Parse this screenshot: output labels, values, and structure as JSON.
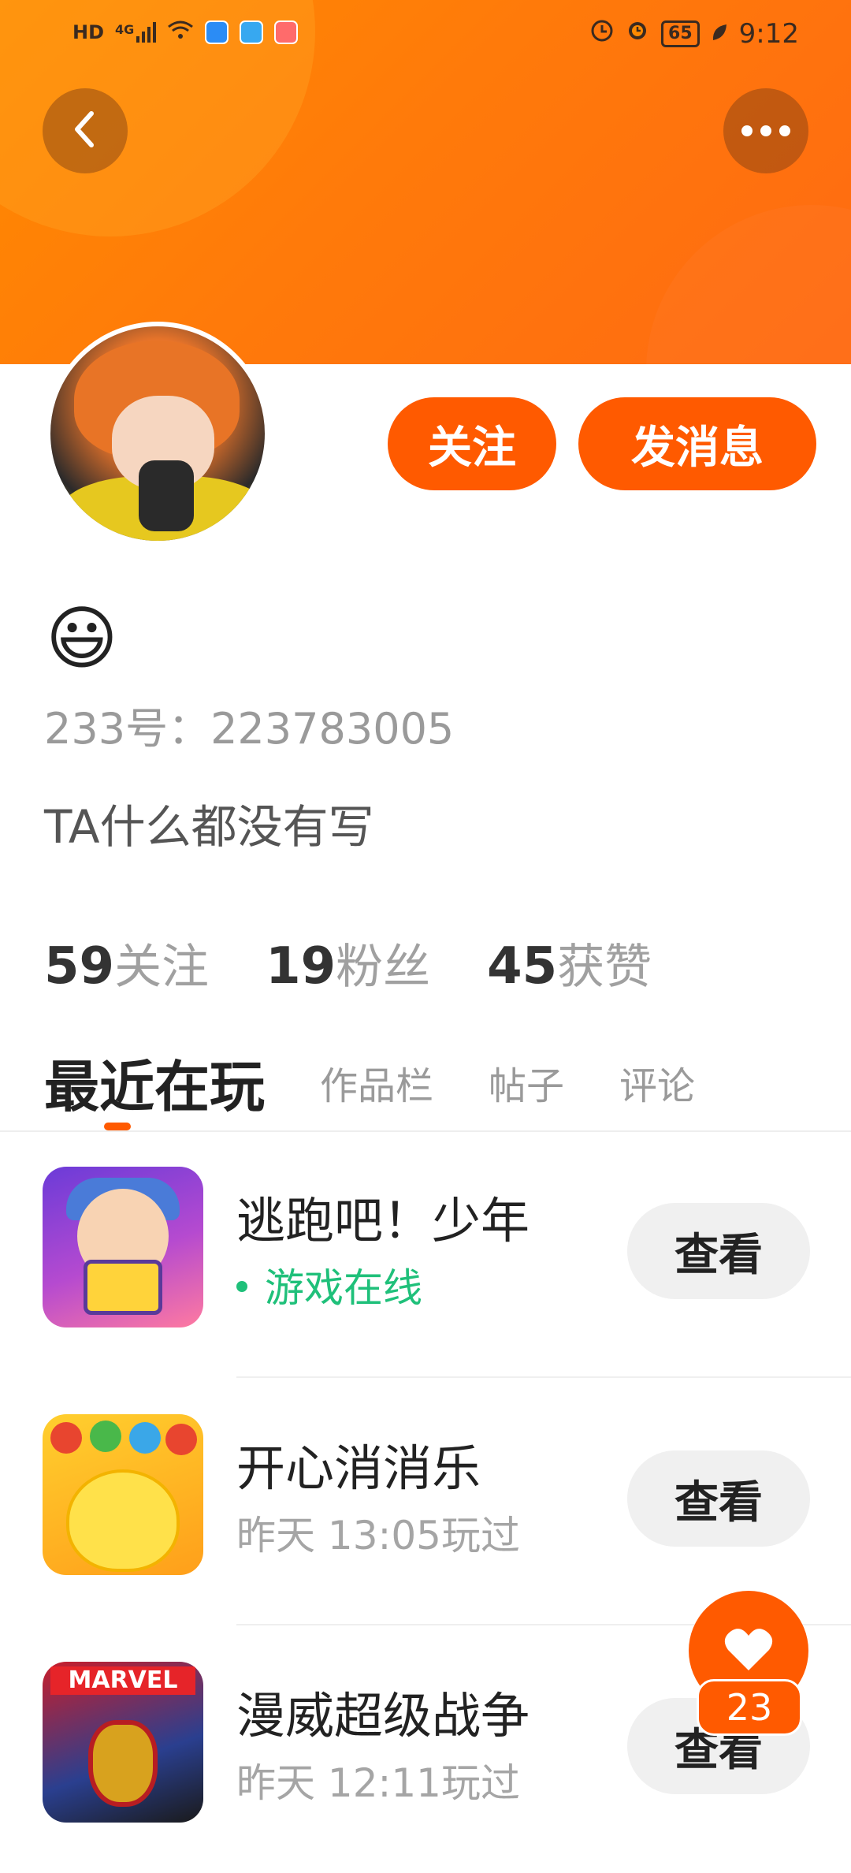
{
  "status_bar": {
    "left_label": "HD",
    "network": "4G",
    "battery": "65",
    "time": "9:12"
  },
  "profile": {
    "name_emoji": "😃",
    "uid_text": "233号：223783005",
    "bio": "TA什么都没有写",
    "follow_label": "关注",
    "message_label": "发消息"
  },
  "stats": [
    {
      "value": "59",
      "label": "关注"
    },
    {
      "value": "19",
      "label": "粉丝"
    },
    {
      "value": "45",
      "label": "获赞"
    }
  ],
  "tabs": [
    {
      "label": "最近在玩",
      "active": true
    },
    {
      "label": "作品栏",
      "active": false
    },
    {
      "label": "帖子",
      "active": false
    },
    {
      "label": "评论",
      "active": false
    }
  ],
  "games": [
    {
      "name": "逃跑吧！少年",
      "status": "游戏在线",
      "online": true,
      "action": "查看",
      "icon": "escape-game-icon"
    },
    {
      "name": "开心消消乐",
      "status": "昨天 13:05玩过",
      "online": false,
      "action": "查看",
      "icon": "happy-match-game-icon"
    },
    {
      "name": "漫威超级战争",
      "status": "昨天 12:11玩过",
      "online": false,
      "action": "查看",
      "icon": "marvel-super-war-icon",
      "logo_text": "MARVEL"
    }
  ],
  "like_fab": {
    "count": "23",
    "icon": "heart-icon"
  },
  "colors": {
    "accent": "#ff5a00",
    "header": "#ff7a0a",
    "online": "#1fc07a"
  }
}
